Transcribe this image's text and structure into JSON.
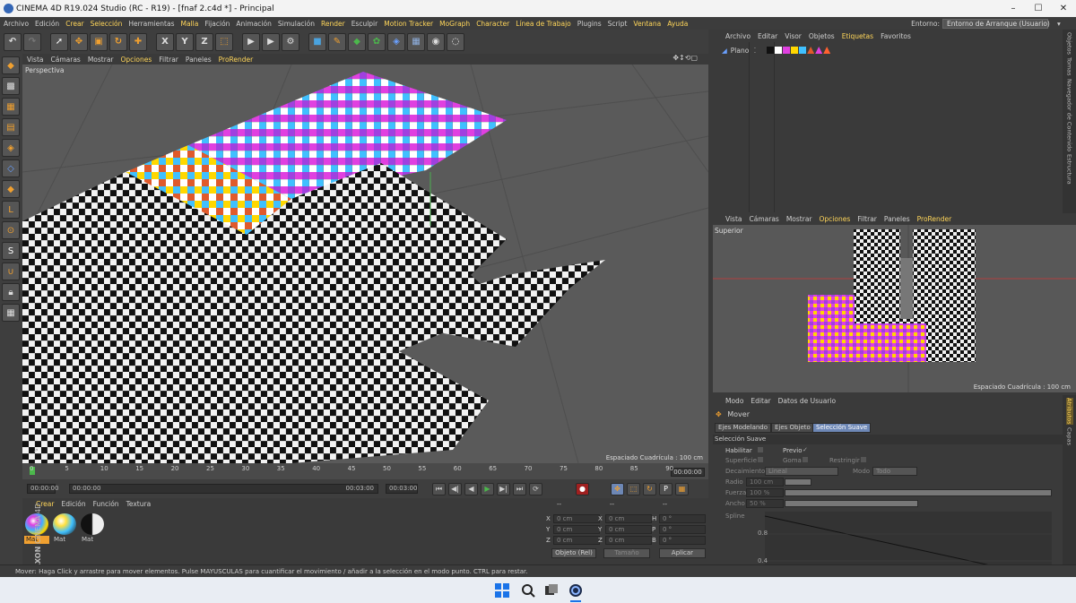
{
  "window": {
    "title": "CINEMA 4D R19.024 Studio (RC - R19) - [fnaf 2.c4d *] - Principal",
    "controls": [
      "–",
      "☐",
      "✕"
    ]
  },
  "menubar": {
    "items": [
      {
        "label": "Archivo",
        "em": false
      },
      {
        "label": "Edición",
        "em": false
      },
      {
        "label": "Crear",
        "em": true
      },
      {
        "label": "Selección",
        "em": true
      },
      {
        "label": "Herramientas",
        "em": false
      },
      {
        "label": "Malla",
        "em": true
      },
      {
        "label": "Fijación",
        "em": false
      },
      {
        "label": "Animación",
        "em": false
      },
      {
        "label": "Simulación",
        "em": false
      },
      {
        "label": "Render",
        "em": true
      },
      {
        "label": "Esculpir",
        "em": false
      },
      {
        "label": "Motion Tracker",
        "em": true
      },
      {
        "label": "MoGraph",
        "em": true
      },
      {
        "label": "Character",
        "em": true
      },
      {
        "label": "Línea de Trabajo",
        "em": true
      },
      {
        "label": "Plugins",
        "em": false
      },
      {
        "label": "Script",
        "em": false
      },
      {
        "label": "Ventana",
        "em": true
      },
      {
        "label": "Ayuda",
        "em": true
      }
    ],
    "layout_label": "Entorno:",
    "layout_value": "Entorno de Arranque (Usuario)"
  },
  "toolbar": {
    "buttons": [
      {
        "name": "undo-button",
        "glyph": "↶",
        "color": "#dddddd"
      },
      {
        "name": "redo-button",
        "glyph": "↷",
        "color": "#777777"
      },
      {
        "name": "live-select-button",
        "glyph": "➚",
        "color": "#ffffff",
        "gap": true
      },
      {
        "name": "move-button",
        "glyph": "✥",
        "color": "#f0a030"
      },
      {
        "name": "scale-button",
        "glyph": "▣",
        "color": "#f0a030"
      },
      {
        "name": "rotate-button",
        "glyph": "↻",
        "color": "#f0a030"
      },
      {
        "name": "last-tool-button",
        "glyph": "✚",
        "color": "#f0a030"
      },
      {
        "name": "x-axis-button",
        "glyph": "X",
        "color": "#dddddd",
        "gap": true
      },
      {
        "name": "y-axis-button",
        "glyph": "Y",
        "color": "#dddddd"
      },
      {
        "name": "z-axis-button",
        "glyph": "Z",
        "color": "#dddddd"
      },
      {
        "name": "coord-system-button",
        "glyph": "⬚",
        "color": "#f0a030"
      },
      {
        "name": "render-view-button",
        "glyph": "▶",
        "color": "#dddddd",
        "gap": true
      },
      {
        "name": "render-picture-viewer-button",
        "glyph": "▶",
        "color": "#dddddd"
      },
      {
        "name": "render-settings-button",
        "glyph": "⚙",
        "color": "#dddddd"
      },
      {
        "name": "cube-button",
        "glyph": "■",
        "color": "#4aa3df",
        "gap": true
      },
      {
        "name": "pen-button",
        "glyph": "✎",
        "color": "#f0a030"
      },
      {
        "name": "subdivision-button",
        "glyph": "◆",
        "color": "#4cb84c"
      },
      {
        "name": "cloner-button",
        "glyph": "✿",
        "color": "#4cb84c"
      },
      {
        "name": "deformer-button",
        "glyph": "◈",
        "color": "#6aa0ff"
      },
      {
        "name": "floor-button",
        "glyph": "▦",
        "color": "#8fb0e0"
      },
      {
        "name": "camera-button",
        "glyph": "◉",
        "color": "#dddddd"
      },
      {
        "name": "light-button",
        "glyph": "◌",
        "color": "#ffffff"
      }
    ]
  },
  "leftbar": {
    "buttons": [
      {
        "name": "make-editable-button",
        "glyph": "◆",
        "color": "#f0a030"
      },
      {
        "name": "model-mode-button",
        "glyph": "▩",
        "color": "#dddddd"
      },
      {
        "name": "texture-mode-button",
        "glyph": "▦",
        "color": "#f0a030"
      },
      {
        "name": "workplane-mode-button",
        "glyph": "▤",
        "color": "#f0a030"
      },
      {
        "name": "points-mode-button",
        "glyph": "◈",
        "color": "#f0a030"
      },
      {
        "name": "edges-mode-button",
        "glyph": "◇",
        "color": "#6aa0ff"
      },
      {
        "name": "polygons-mode-button",
        "glyph": "◆",
        "color": "#f0a030"
      },
      {
        "name": "axis-mode-button",
        "glyph": "L",
        "color": "#f0a030"
      },
      {
        "name": "tweak-mode-button",
        "glyph": "⊙",
        "color": "#f0a030"
      },
      {
        "name": "snap-button",
        "glyph": "S",
        "color": "#ffffff"
      },
      {
        "name": "magnet-button",
        "glyph": "∪",
        "color": "#f0a030"
      },
      {
        "name": "lock-button",
        "glyph": "🔒︎",
        "color": "#dddddd"
      },
      {
        "name": "grid-button",
        "glyph": "▦",
        "color": "#dddddd"
      }
    ]
  },
  "viewport": {
    "menu": [
      {
        "label": "Vista",
        "em": false
      },
      {
        "label": "Cámaras",
        "em": false
      },
      {
        "label": "Mostrar",
        "em": false
      },
      {
        "label": "Opciones",
        "em": true
      },
      {
        "label": "Filtrar",
        "em": false
      },
      {
        "label": "Paneles",
        "em": false
      },
      {
        "label": "ProRender",
        "em": true
      }
    ],
    "label": "Perspectiva",
    "grid_spacing": "Espaciado Cuadrícula : 100 cm",
    "nav_icons": "✥↕⟲▢"
  },
  "timeline": {
    "ticks": [
      "0",
      "5",
      "10",
      "15",
      "20",
      "25",
      "30",
      "35",
      "40",
      "45",
      "50",
      "55",
      "60",
      "65",
      "70",
      "75",
      "80",
      "85",
      "90"
    ],
    "end_frame": "00:00:00"
  },
  "transport": {
    "current_time": "00:00:00",
    "min_time": "00:00:00",
    "max_time": "00:03:00",
    "end_time": "00:03:00",
    "buttons": [
      "⏮",
      "◀|",
      "◀",
      "▶",
      "▶|",
      "⏭",
      "⟳"
    ],
    "key_buttons": [
      "✥",
      "⬚",
      "↻",
      "P",
      "▦"
    ]
  },
  "material_manager": {
    "menu": [
      {
        "label": "Crear",
        "em": true
      },
      {
        "label": "Edición",
        "em": false
      },
      {
        "label": "Función",
        "em": false
      },
      {
        "label": "Textura",
        "em": false
      }
    ],
    "materials": [
      {
        "name": "Mat",
        "selected": true,
        "gradient": "radial-gradient(circle at 35% 35%,#fff 0%,#e040e0 20%,#40b0ff 45%,#ffd700 70%,#222 95%)"
      },
      {
        "name": "Mat",
        "selected": false,
        "gradient": "radial-gradient(circle at 35% 35%,#fff 0%,#ffe040 25%,#40c0ff 55%,#202020 95%)"
      },
      {
        "name": "Mat",
        "selected": false,
        "gradient": "linear-gradient(90deg,#111 0%,#111 48%,#eee 52%,#eee 100%)"
      }
    ],
    "brand": [
      "MAXON",
      "CINEMA 4D"
    ]
  },
  "coordinates": {
    "header": [
      "--",
      "--",
      "--"
    ],
    "rows": [
      {
        "a": "X",
        "av": "0 cm",
        "b": "X",
        "bv": "0 cm",
        "c": "H",
        "cv": "0 °"
      },
      {
        "a": "Y",
        "av": "0 cm",
        "b": "Y",
        "bv": "0 cm",
        "c": "P",
        "cv": "0 °"
      },
      {
        "a": "Z",
        "av": "0 cm",
        "b": "Z",
        "bv": "0 cm",
        "c": "B",
        "cv": "0 °"
      }
    ],
    "mode": "Objeto (Rel)",
    "size_mode": "Tamaño",
    "apply": "Aplicar"
  },
  "object_manager": {
    "menu": [
      {
        "label": "Archivo",
        "em": false
      },
      {
        "label": "Editar",
        "em": false
      },
      {
        "label": "Visor",
        "em": false
      },
      {
        "label": "Objetos",
        "em": false
      },
      {
        "label": "Etiquetas",
        "em": true
      },
      {
        "label": "Favoritos",
        "em": false
      }
    ],
    "object_name": "Plano",
    "tag_colors": [
      "#111111",
      "#ffffff",
      "#e040e0",
      "#ffd700",
      "#40c0ff",
      "#e05a2b",
      "#e040e0",
      "#ff6030"
    ],
    "side_tabs": [
      "Objetos",
      "Tomas",
      "Navegador de Contenido",
      "Estructura"
    ]
  },
  "top_view": {
    "menu": [
      {
        "label": "Vista",
        "em": false
      },
      {
        "label": "Cámaras",
        "em": false
      },
      {
        "label": "Mostrar",
        "em": false
      },
      {
        "label": "Opciones",
        "em": true
      },
      {
        "label": "Filtrar",
        "em": false
      },
      {
        "label": "Paneles",
        "em": false
      },
      {
        "label": "ProRender",
        "em": true
      }
    ],
    "label": "Superior",
    "grid_spacing": "Espaciado Cuadrícula : 100 cm"
  },
  "attributes": {
    "menu": [
      "Modo",
      "Editar",
      "Datos de Usuario"
    ],
    "tool_name": "Mover",
    "tabs": [
      {
        "label": "Ejes Modelando",
        "on": false
      },
      {
        "label": "Ejes Objeto",
        "on": false
      },
      {
        "label": "Selección Suave",
        "on": true
      }
    ],
    "section": "Selección Suave",
    "habilitar": "Habilitar",
    "previo": "Previo",
    "superficie": "Superficie",
    "goma": "Goma",
    "restringir": "Restringir",
    "decaimiento_label": "Decaimiento",
    "decaimiento": "Lineal",
    "modo_label": "Modo",
    "modo": "Todo",
    "radio_label": "Radio",
    "radio": "100 cm",
    "fuerza_label": "Fuerza",
    "fuerza": "100 %",
    "ancho_label": "Ancho",
    "ancho": "50 %",
    "spline_label": "Spline",
    "spline_ticks": [
      "0.8",
      "0.4"
    ],
    "side_tabs": [
      "Atributos",
      "Capas"
    ]
  },
  "status_bar": {
    "text": "Mover: Haga Click y arrastre para mover elementos. Pulse MAYUSCULAS para cuantificar el movimiento / añadir a la selección en el modo punto. CTRL para restar."
  },
  "taskbar": {
    "icons": [
      "windows-start-icon",
      "search-icon",
      "task-view-icon",
      "cinema4d-app-icon"
    ]
  }
}
